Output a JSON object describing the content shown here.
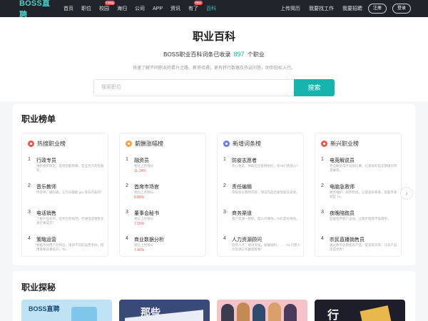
{
  "nav": {
    "logo": "BOSS直聘",
    "links": [
      "首页",
      "职位",
      "校园",
      "海归",
      "公司",
      "APP",
      "资讯",
      "有了",
      "百科"
    ],
    "badges": {
      "campus": "Hiring",
      "youle": "New"
    },
    "right_links": [
      "上传简历",
      "我要找工作",
      "我要招聘"
    ],
    "register": "注册",
    "login": "登录"
  },
  "hero": {
    "title": "职业百科",
    "count_prefix": "BOSS职业百科词条已收录",
    "count": "897",
    "count_suffix": "个职业",
    "desc": "快速了解不同职业的晋升之路、薪资待遇，更有转行数据及热议问答，助你轻松入行。",
    "search_placeholder": "搜索职位",
    "search_button": "搜索"
  },
  "rank": {
    "title": "职业榜单",
    "columns": [
      {
        "title": "热搜职业榜",
        "color": "#f0564f",
        "items": [
          {
            "rank": "1",
            "name": "行政专员",
            "desc": "维护组织稳定，提供后勤保障，是业务方的后备军。"
          },
          {
            "rank": "2",
            "name": "音乐教师",
            "desc": "传音律，播沟通，让学员都能 get 音乐的美妙！"
          },
          {
            "rank": "3",
            "name": "电话销售",
            "desc": "了解产品卖点，话术包装规范，打通电话销售任意行事成交！"
          },
          {
            "rank": "4",
            "name": "策略运营",
            "desc": "根据不同用户的特征，策划不同的运营手段，提用策略良事提升，Ta..."
          }
        ]
      },
      {
        "title": "薪酬涨幅榜",
        "color": "#f3a23a",
        "items": [
          {
            "rank": "1",
            "name": "融资员",
            "desc": "相比上月增长",
            "pct": "11.14%"
          },
          {
            "rank": "2",
            "name": "首席市场官",
            "desc": "相比上月增长",
            "pct": "8.88%"
          },
          {
            "rank": "3",
            "name": "董事会秘书",
            "desc": "相比上月增长",
            "pct": "7.55%"
          },
          {
            "rank": "4",
            "name": "商业数据分析",
            "desc": "相比上月增长",
            "pct": "7.46%"
          }
        ]
      },
      {
        "title": "新增词条榜",
        "color": "#6a7bef",
        "items": [
          {
            "rank": "1",
            "name": "防疫志愿者",
            "desc": "热心善良，协助社区疫情防控，有Ta们更放心！"
          },
          {
            "rank": "2",
            "name": "责任编辑",
            "desc": "审核加工稿件内容，保证作品出版优质又高效。"
          },
          {
            "rank": "3",
            "name": "商务渠道",
            "desc": "客户资源一把抓，帮公司赚钱，Ta们是好样的。"
          },
          {
            "rank": "4",
            "name": "人力资源顾问",
            "desc": "选贤人才，绩效考核，薪酬福利，……Ta 们把人力资源工作做到极致！"
          }
        ]
      },
      {
        "title": "新兴职业榜",
        "color": "#f0564f",
        "items": [
          {
            "rank": "1",
            "name": "电竞解说员",
            "desc": "专业解说电子竞技比赛，让紧张的电竞激情的完美展现。"
          },
          {
            "rank": "2",
            "name": "电脑急救师",
            "desc": "硬件维护、软件检修，让能查杂病毒，电脑专家就是 Ta。"
          },
          {
            "rank": "3",
            "name": "夜晚陪跑员",
            "desc": "监督陪伴客户运动，让跑步锻炼不再孤单。"
          },
          {
            "rank": "4",
            "name": "农民直播销售员",
            "desc": "通过数字化销售农产品，提高购买率，让农产品走向世界！"
          }
        ]
      }
    ],
    "next_icon": "chevron-right-icon"
  },
  "explore": {
    "title": "职业探秘",
    "thumbs": [
      {
        "text": "BOSS直聘",
        "bg": "#bfe3f4"
      },
      {
        "text": "那些",
        "bg": "#3a4a78"
      },
      {
        "text": "",
        "bg": "#f4c3c7"
      },
      {
        "text": "行",
        "bg": "#1e1e2a"
      }
    ]
  }
}
